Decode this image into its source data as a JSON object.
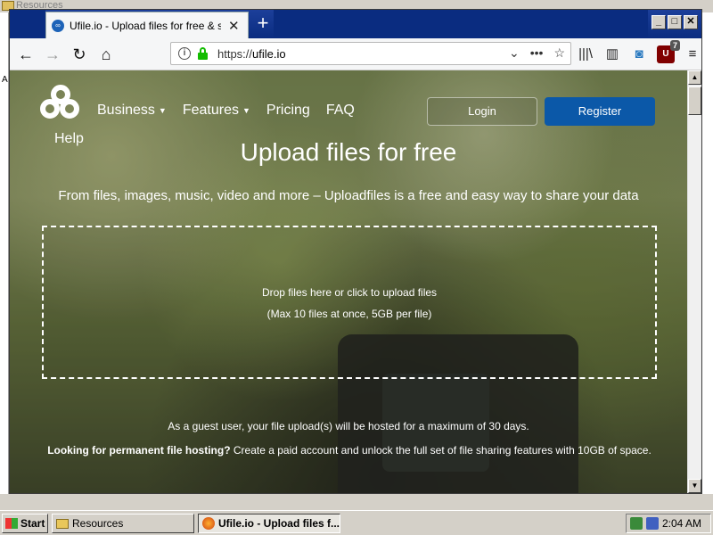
{
  "desktop": {
    "bg_window_title": "Resources",
    "left_edge_text": "A"
  },
  "browser": {
    "tab": {
      "favicon": "ufile-cloud-icon",
      "title": "Ufile.io - Upload files for free & sh",
      "close": "✕"
    },
    "new_tab": "+",
    "window_buttons": {
      "minimize": "_",
      "maximize": "□",
      "close": "✕"
    },
    "nav": {
      "back": "←",
      "forward": "→",
      "reload": "↻",
      "home": "⌂"
    },
    "url": {
      "scheme": "https://",
      "host": "ufile.io",
      "dropdown": "⌄",
      "more": "•••",
      "bookmark": "☆"
    },
    "toolbar": {
      "library": "|||\\",
      "sidebar": "▥",
      "screenshot": "◙",
      "ublock_badge": "7",
      "ublock_label": "U",
      "menu": "≡"
    }
  },
  "page": {
    "help": "Help",
    "nav_items": [
      {
        "label": "Business",
        "has_caret": true
      },
      {
        "label": "Features",
        "has_caret": true
      },
      {
        "label": "Pricing",
        "has_caret": false
      },
      {
        "label": "FAQ",
        "has_caret": false
      }
    ],
    "caret": "▼",
    "login": "Login",
    "register": "Register",
    "hero_title": "Upload files for free",
    "hero_subtitle": "From files, images, music, video and more – Uploadfiles is a free and easy way to share your data",
    "dropzone": {
      "line1": "Drop files here or click to upload files",
      "line2": "(Max 10 files at once, 5GB per file)"
    },
    "guest_note": "As a guest user, your file upload(s) will be hosted for a maximum of 30 days.",
    "perm_bold": "Looking for permanent file hosting?",
    "perm_rest": " Create a paid account and unlock the full set of file sharing features with 10GB of space."
  },
  "taskbar": {
    "start": "Start",
    "tasks": [
      {
        "label": "Resources",
        "active": false
      },
      {
        "label": "Ufile.io - Upload files f...",
        "active": true
      }
    ],
    "clock": "2:04 AM"
  }
}
